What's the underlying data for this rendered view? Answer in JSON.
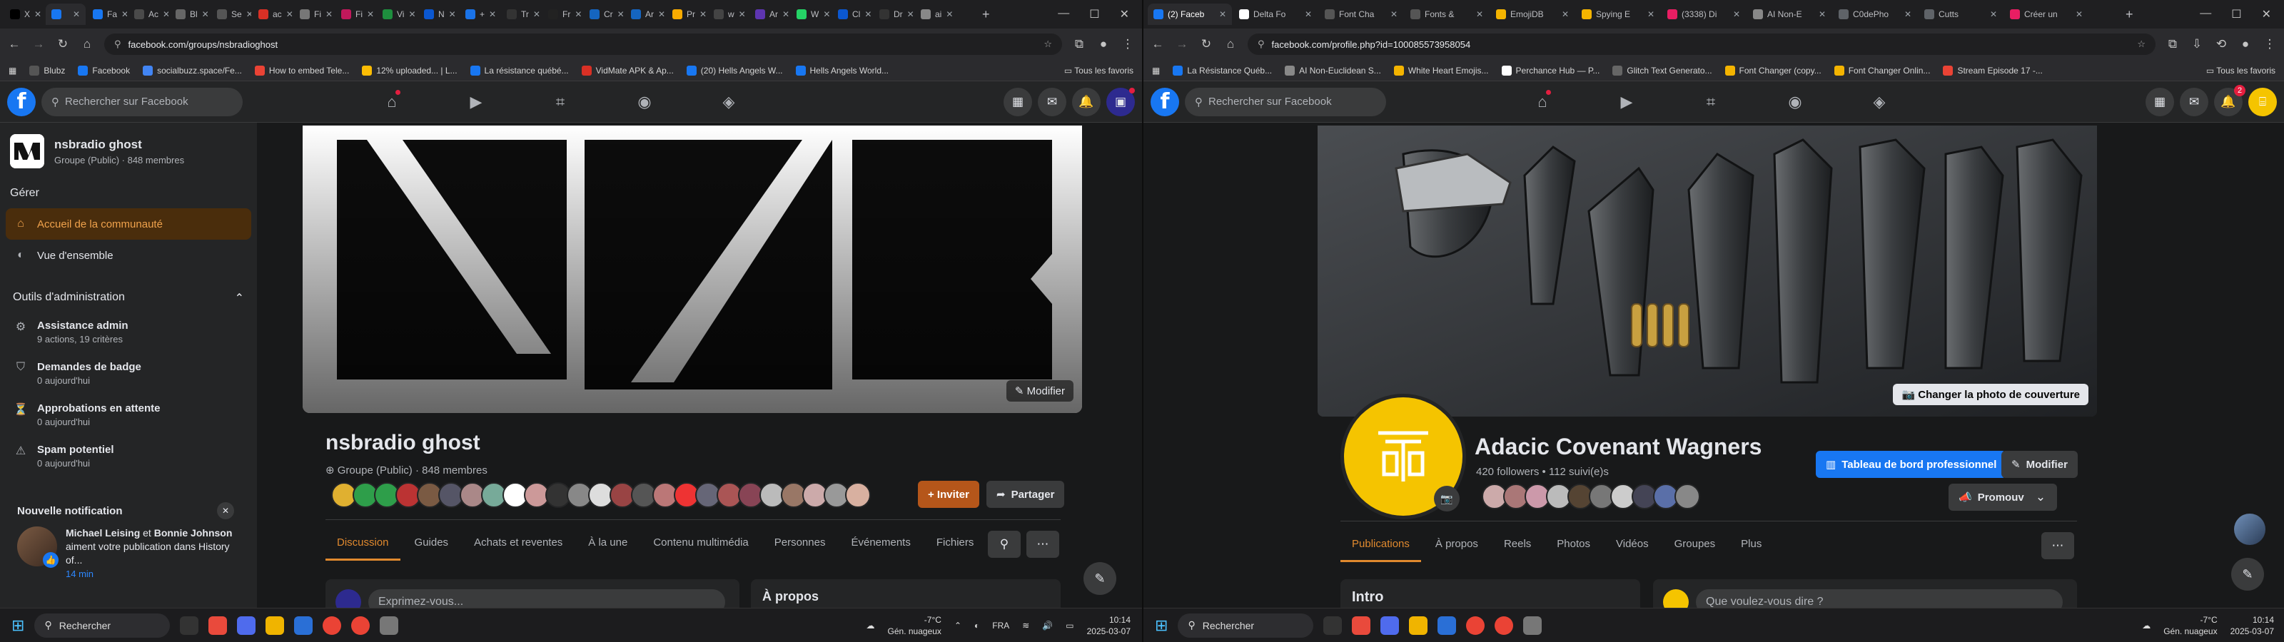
{
  "left": {
    "tabs": [
      {
        "label": "X",
        "color": "#000000",
        "active": false
      },
      {
        "label": "",
        "color": "#1877f2",
        "active": true
      },
      {
        "label": "Fa",
        "color": "#1877f2",
        "active": false
      },
      {
        "label": "Ac",
        "color": "#4a4a4a",
        "active": false
      },
      {
        "label": "Bl",
        "color": "#666666",
        "active": false
      },
      {
        "label": "Se",
        "color": "#555555",
        "active": false
      },
      {
        "label": "ac",
        "color": "#d93025",
        "active": false
      },
      {
        "label": "Fi",
        "color": "#777777",
        "active": false
      },
      {
        "label": "Fi",
        "color": "#c2185b",
        "active": false
      },
      {
        "label": "Vi",
        "color": "#1e8e3e",
        "active": false
      },
      {
        "label": "N",
        "color": "#0b57d0",
        "active": false
      },
      {
        "label": "+",
        "color": "#1a73e8",
        "active": false
      },
      {
        "label": "Tr",
        "color": "#333333",
        "active": false
      },
      {
        "label": "Fr",
        "color": "#222222",
        "active": false
      },
      {
        "label": "Cr",
        "color": "#1565c0",
        "active": false
      },
      {
        "label": "Ar",
        "color": "#1565c0",
        "active": false
      },
      {
        "label": "Pr",
        "color": "#f9ab00",
        "active": false
      },
      {
        "label": "w",
        "color": "#444444",
        "active": false
      },
      {
        "label": "Ar",
        "color": "#5e35b1",
        "active": false
      },
      {
        "label": "W",
        "color": "#25d366",
        "active": false
      },
      {
        "label": "Cl",
        "color": "#0b57d0",
        "active": false
      },
      {
        "label": "Dr",
        "color": "#333333",
        "active": false
      },
      {
        "label": "ai",
        "color": "#888888",
        "active": false
      }
    ],
    "url": "facebook.com/groups/nsbradioghost",
    "bookmarks": [
      {
        "label": "Blubz",
        "color": "#555"
      },
      {
        "label": "Facebook",
        "color": "#1877f2"
      },
      {
        "label": "socialbuzz.space/Fe...",
        "color": "#4285f4"
      },
      {
        "label": "How to embed Tele...",
        "color": "#ea4335"
      },
      {
        "label": "12% uploaded... | L...",
        "color": "#fbbc04"
      },
      {
        "label": "La résistance québé...",
        "color": "#1877f2"
      },
      {
        "label": "VidMate APK & Ap...",
        "color": "#d93025"
      },
      {
        "label": "(20) Hells Angels W...",
        "color": "#1877f2"
      },
      {
        "label": "Hells Angels World...",
        "color": "#1877f2"
      }
    ],
    "bookmarks_all": "Tous les favoris",
    "search_placeholder": "Rechercher sur Facebook",
    "group": {
      "name": "nsbradio ghost",
      "meta": "Groupe (Public) · 848 membres"
    },
    "manage_label": "Gérer",
    "nav": [
      {
        "label": "Accueil de la communauté",
        "icon": "home-icon",
        "active": true
      },
      {
        "label": "Vue d'ensemble",
        "icon": "overview-icon",
        "active": false
      }
    ],
    "admin_tools": "Outils d'administration",
    "admin_items": [
      {
        "title": "Assistance admin",
        "sub": "9 actions, 19 critères"
      },
      {
        "title": "Demandes de badge",
        "sub": "0 aujourd'hui"
      },
      {
        "title": "Approbations en attente",
        "sub": "0 aujourd'hui"
      },
      {
        "title": "Spam potentiel",
        "sub": "0 aujourd'hui"
      }
    ],
    "notification": {
      "heading": "Nouvelle notification",
      "name1": "Michael Leising",
      "conj": "et",
      "name2": "Bonnie Johnson",
      "text": "aiment votre publication dans History of...",
      "time": "14 min"
    },
    "cover_button": "Modifier",
    "title": "nsbradio ghost",
    "subtitle": "Groupe (Public) · 848 membres",
    "invite": "+ Inviter",
    "share": "Partager",
    "tabs_main": [
      "Discussion",
      "Guides",
      "Achats et reventes",
      "À la une",
      "Contenu multimédia",
      "Personnes",
      "Événements",
      "Fichiers"
    ],
    "composer": "Exprimez-vous...",
    "about": "À propos"
  },
  "right": {
    "tabs": [
      {
        "label": "(2) Faceb",
        "color": "#1877f2",
        "active": true
      },
      {
        "label": "Delta Fo",
        "color": "#ffffff",
        "active": false
      },
      {
        "label": "Font Cha",
        "color": "#555",
        "active": false
      },
      {
        "label": "Fonts &",
        "color": "#555",
        "active": false
      },
      {
        "label": "EmojiDB",
        "color": "#f4b400",
        "active": false
      },
      {
        "label": "Spying E",
        "color": "#f4b400",
        "active": false
      },
      {
        "label": "(3338) Di",
        "color": "#e91e63",
        "active": false
      },
      {
        "label": "AI Non-E",
        "color": "#888",
        "active": false
      },
      {
        "label": "C0dePho",
        "color": "#5f6368",
        "active": false
      },
      {
        "label": "Cutts",
        "color": "#5f6368",
        "active": false
      },
      {
        "label": "Créer un",
        "color": "#e91e63",
        "active": false
      }
    ],
    "url": "facebook.com/profile.php?id=100085573958054",
    "bookmarks": [
      {
        "label": "La Résistance Québ...",
        "color": "#1877f2"
      },
      {
        "label": "AI Non-Euclidean S...",
        "color": "#888"
      },
      {
        "label": "White Heart Emojis...",
        "color": "#f4b400"
      },
      {
        "label": "Perchance Hub — P...",
        "color": "#fff"
      },
      {
        "label": "Glitch Text Generato...",
        "color": "#666"
      },
      {
        "label": "Font Changer (copy...",
        "color": "#f4b400"
      },
      {
        "label": "Font Changer Onlin...",
        "color": "#f4b400"
      },
      {
        "label": "Stream Episode 17 -...",
        "color": "#ea4335"
      }
    ],
    "bookmarks_all": "Tous les favoris",
    "search_placeholder": "Rechercher sur Facebook",
    "notif_count": "2",
    "cover_button": "Changer la photo de couverture",
    "name": "Adacic Covenant Wagners",
    "followers": "420 followers • 112 suivi(e)s",
    "dashboard": "Tableau de bord professionnel",
    "edit": "Modifier",
    "promote": "Promouvoir",
    "tabs_main": [
      "Publications",
      "À propos",
      "Reels",
      "Photos",
      "Vidéos",
      "Groupes",
      "Plus"
    ],
    "intro": "Intro",
    "composer": "Que voulez-vous dire ?"
  },
  "taskbar": {
    "search": "Rechercher",
    "weather_temp": "-7°C",
    "weather_desc": "Gén. nuageux",
    "lang": "FRA",
    "time": "10:14",
    "date": "2025-03-07"
  }
}
